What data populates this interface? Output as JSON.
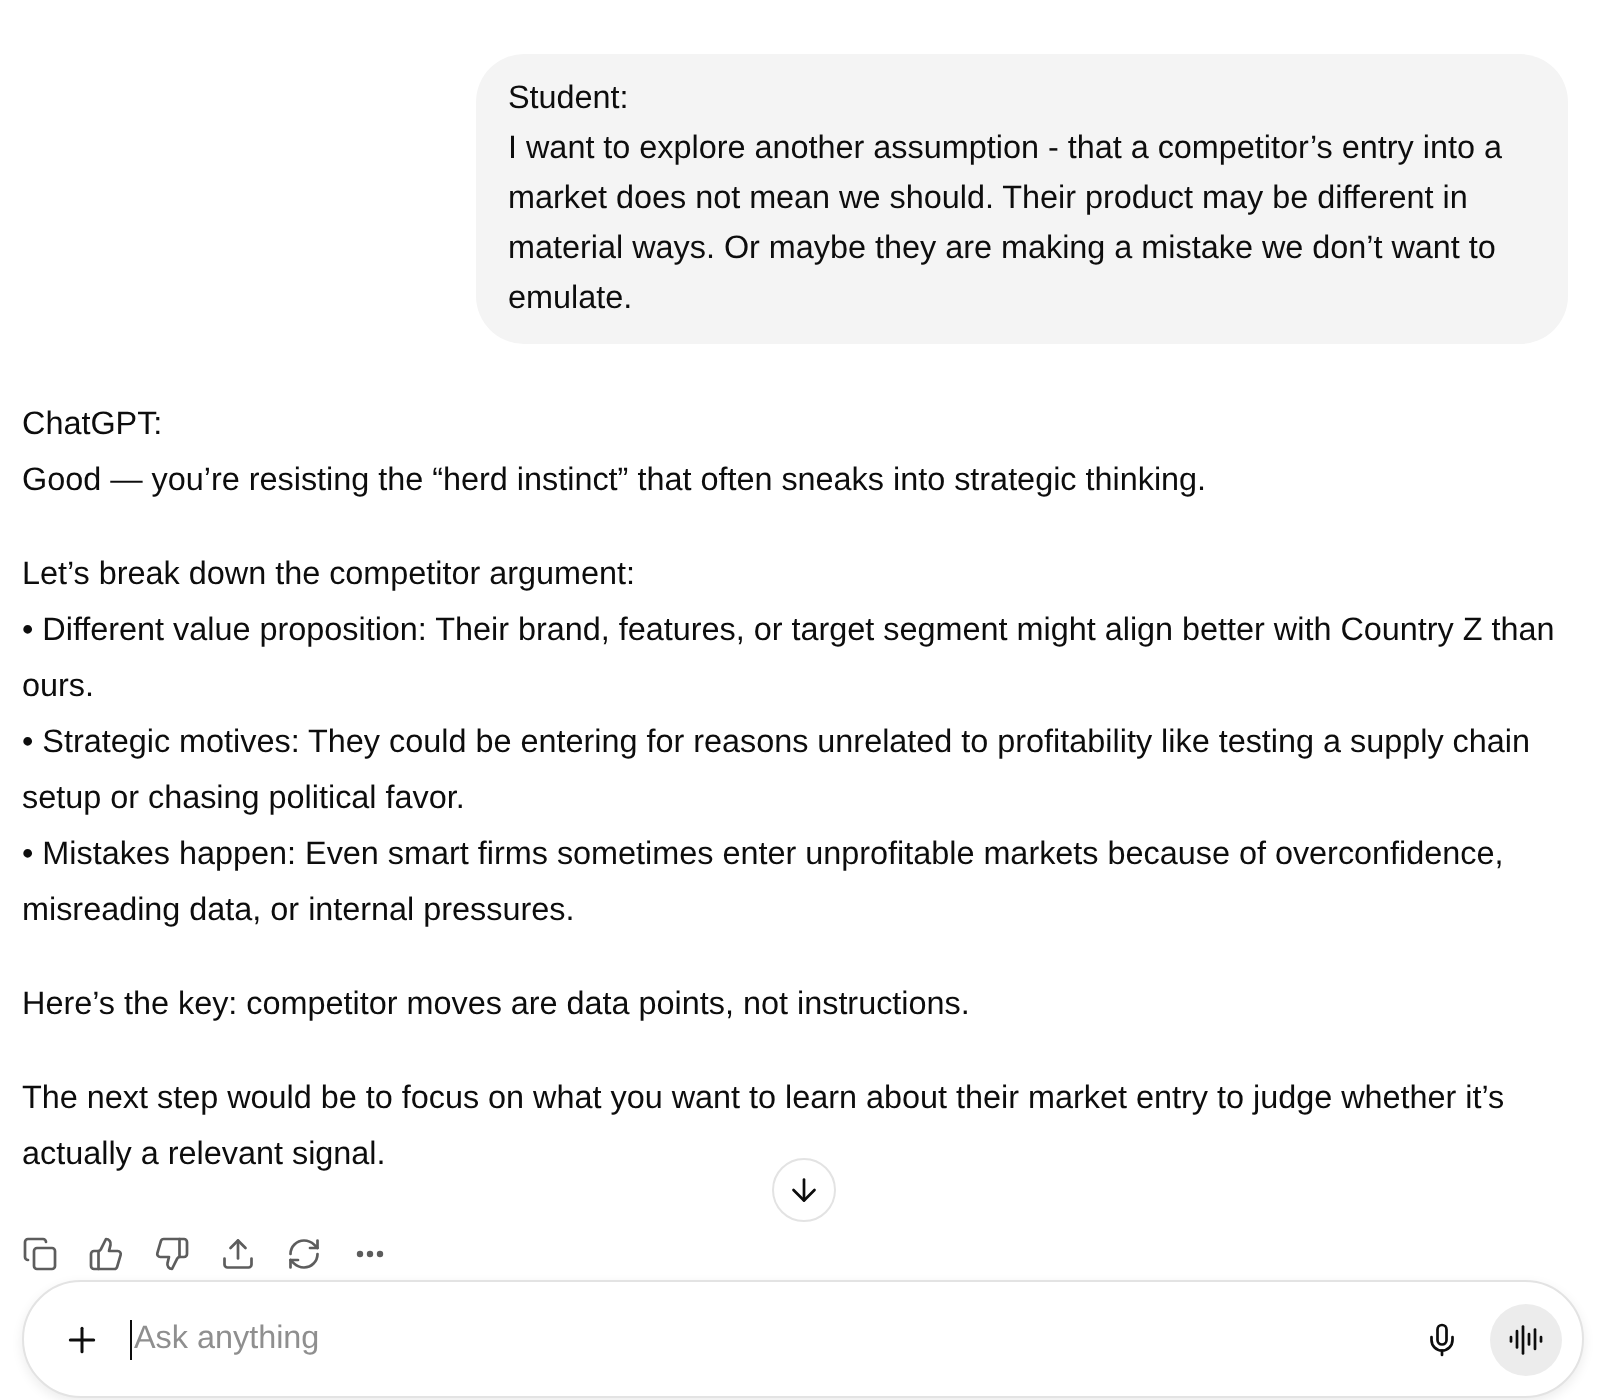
{
  "user_message": {
    "author": "Student:",
    "text": "I want to explore another assumption - that a competitor’s entry into a market does not mean we should. Their product may be different in material ways. Or maybe they are making a mistake we don’t want to emulate."
  },
  "assistant_message": {
    "author": "ChatGPT:",
    "blocks": [
      {
        "lines": [
          "Good — you’re resisting the “herd instinct” that often sneaks into strategic thinking."
        ]
      },
      {
        "lines": [
          "Let’s break down the competitor argument:",
          "• Different value proposition: Their brand, features, or target segment might align better with Country Z than ours.",
          "• Strategic motives: They could be entering for reasons unrelated to profitability like testing a supply chain setup or chasing political favor.",
          "• Mistakes happen: Even smart firms sometimes enter unprofitable markets because of overconfidence, misreading data, or internal pressures."
        ]
      },
      {
        "lines": [
          "Here’s the key: competitor moves are data points, not instructions."
        ]
      },
      {
        "lines": [
          "The next step would be to focus on what you want to learn about their market entry to judge whether it’s actually a relevant signal."
        ]
      }
    ]
  },
  "composer": {
    "placeholder": "Ask anything"
  }
}
